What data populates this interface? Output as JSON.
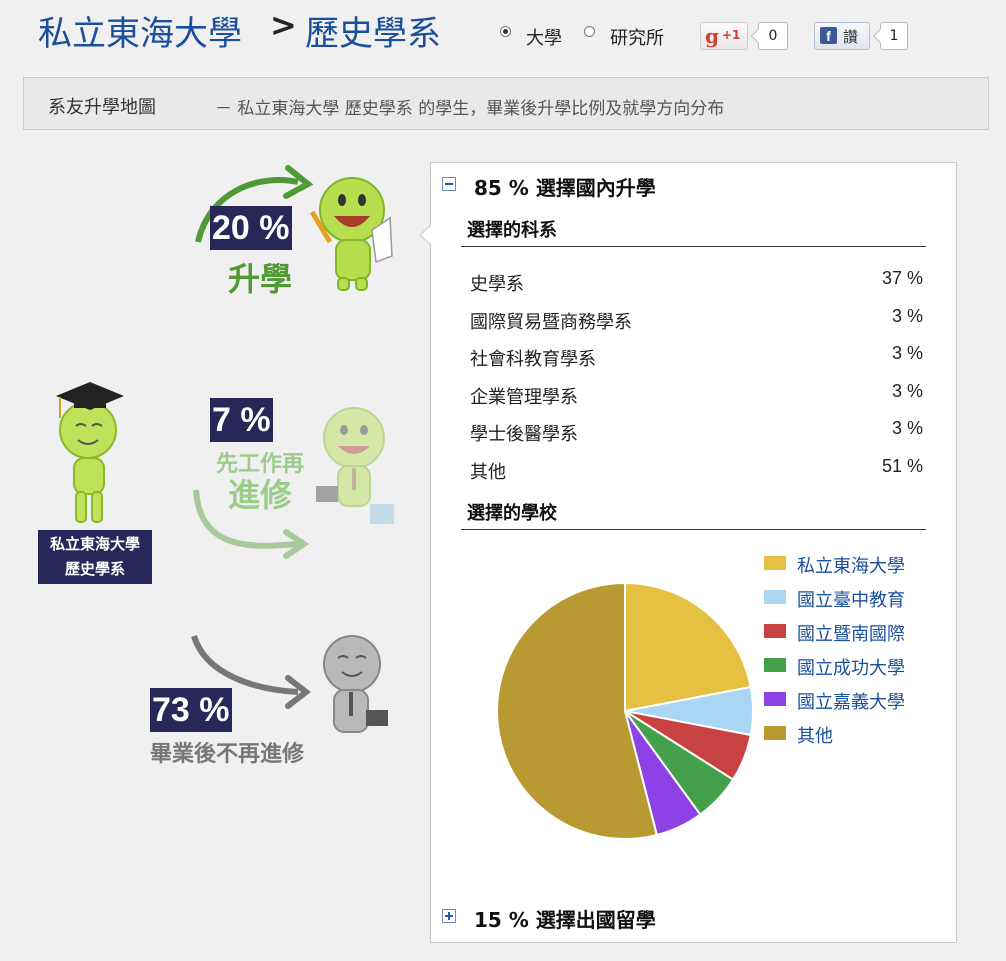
{
  "header": {
    "university": "私立東海大學",
    "separator": ">",
    "department": "歷史學系",
    "radio_university": "大學",
    "radio_graduate": "研究所",
    "gplus_label": "+1",
    "gplus_count": "0",
    "fb_label": "讚",
    "fb_count": "1"
  },
  "banner": {
    "label": "系友升學地圖",
    "description": "－ 私立東海大學 歷史學系 的學生，畢業後升學比例及就學方向分布"
  },
  "diagram": {
    "school_line1": "私立東海大學",
    "school_line2": "歷史學系",
    "further_study_pct": "20 %",
    "further_study_caption": "升學",
    "work_first_pct": "7 %",
    "work_first_caption_top": "先工作再",
    "work_first_caption_bottom": "進修",
    "no_study_pct": "73 %",
    "no_study_caption": "畢業後不再進修"
  },
  "panel": {
    "domestic_pct": "85 %",
    "domestic_label": "選擇國內升學",
    "departments_heading": "選擇的科系",
    "departments": [
      {
        "name": "史學系",
        "pct": "37 %"
      },
      {
        "name": "國際貿易暨商務學系",
        "pct": "3 %"
      },
      {
        "name": "社會科教育學系",
        "pct": "3 %"
      },
      {
        "name": "企業管理學系",
        "pct": "3 %"
      },
      {
        "name": "學士後醫學系",
        "pct": "3 %"
      },
      {
        "name": "其他",
        "pct": "51 %"
      }
    ],
    "schools_heading": "選擇的學校",
    "abroad_pct": "15 %",
    "abroad_label": "選擇出國留學"
  },
  "chart_data": {
    "type": "pie",
    "labels": [
      "私立東海大學",
      "國立臺中教育",
      "國立暨南國際",
      "國立成功大學",
      "國立嘉義大學",
      "其他"
    ],
    "values": [
      22,
      6,
      6,
      6,
      6,
      54
    ],
    "colors": [
      "#e6c040",
      "#aad6f4",
      "#c94242",
      "#44a04a",
      "#8e42e6",
      "#b99a32"
    ],
    "legend": "right"
  }
}
